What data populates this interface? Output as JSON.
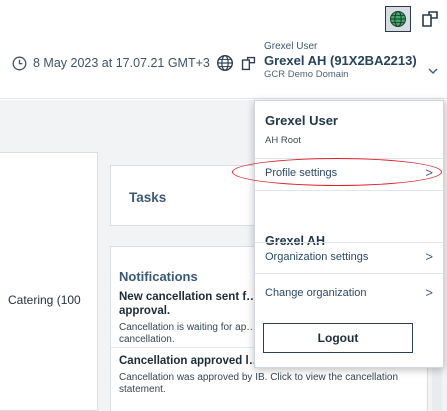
{
  "header": {
    "datetime": "8 May 2023 at 17.07.21 GMT+3",
    "user_type": "Grexel User",
    "account": "Grexel AH (91X2BA2213)",
    "domain": "GCR Demo Domain"
  },
  "cards": {
    "left_fragment": "Catering (100",
    "tasks_title": "Tasks",
    "notifications_title": "Notifications",
    "notification_1_title": "New cancellation sent f… approval.",
    "notification_1_body": "Cancellation is waiting for ap… cancellation.",
    "notification_2_title": "Cancellation approved l…",
    "notification_2_body": "Cancellation was approved by IB. Click to view the cancellation statement."
  },
  "dropdown": {
    "user_name": "Grexel User",
    "role": "AH Root",
    "profile_settings": "Profile settings",
    "org_name": "Grexel AH",
    "organization_settings": "Organization settings",
    "change_organization": "Change organization",
    "logout": "Logout",
    "arrow": ">"
  },
  "icons": {
    "clock": "clock-icon",
    "globe": "globe-icon",
    "external": "external-window-icon",
    "chevron": "chevron-down-icon"
  },
  "colors": {
    "highlight": "#e0202b",
    "accent": "#2b4a66"
  }
}
